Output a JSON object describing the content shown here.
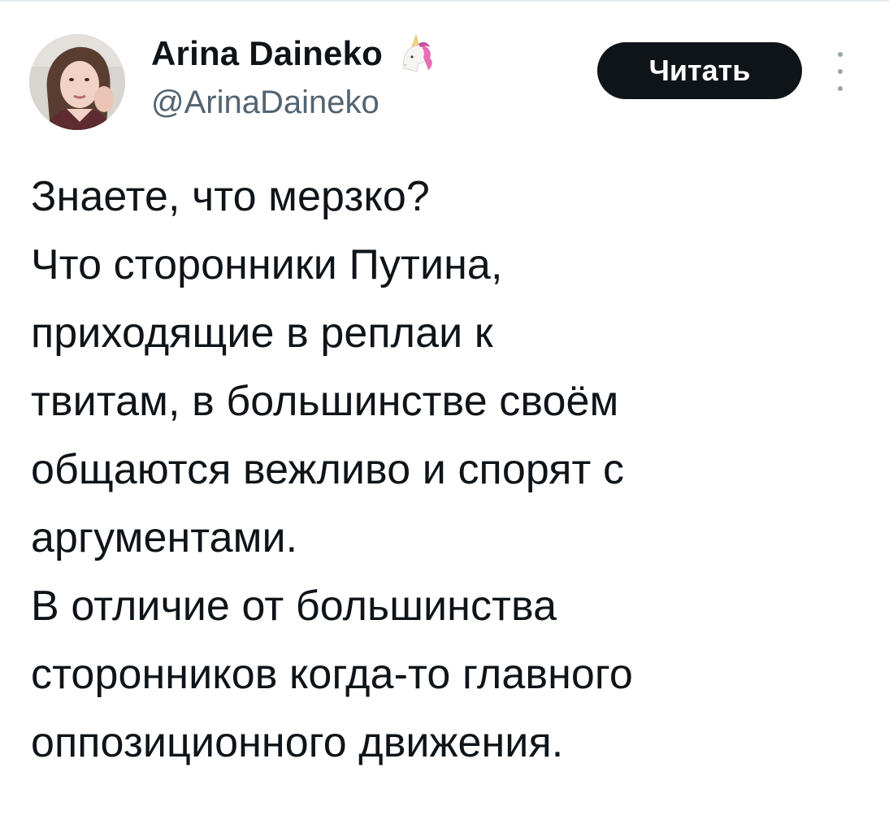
{
  "author": {
    "display_name": "Arina Daineko",
    "name_emoji": "unicorn-icon",
    "handle": "@ArinaDaineko"
  },
  "actions": {
    "follow_label": "Читать",
    "more_icon": "more-vertical-icon"
  },
  "tweet": {
    "lines": [
      "Знаете, что мерзко?",
      "Что сторонники Путина,",
      "приходящие в реплаи к",
      "твитам, в большинстве своём",
      "общаются вежливо и спорят с",
      "аргументами.",
      "В отличие от большинства",
      "сторонников когда-то главного",
      "оппозиционного движения."
    ]
  },
  "colors": {
    "text_primary": "#0f1419",
    "text_secondary": "#536471",
    "follow_button_bg": "#0f1419",
    "background": "#ffffff"
  }
}
